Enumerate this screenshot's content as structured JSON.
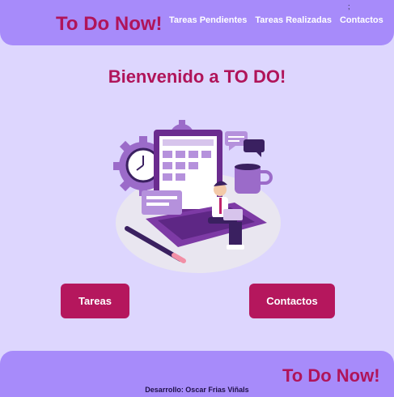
{
  "header": {
    "brand": "To Do Now!",
    "nav": [
      {
        "label": "Tareas Pendientes"
      },
      {
        "label": "Tareas Realizadas"
      },
      {
        "label": "Contactos"
      }
    ],
    "stray_mark": ";"
  },
  "main": {
    "welcome": "Bienvenido a TO DO!",
    "hero_image": "person-working-on-laptop-illustration",
    "buttons": {
      "tareas": "Tareas",
      "contactos": "Contactos"
    }
  },
  "footer": {
    "brand": "To Do Now!",
    "credit": "Desarrollo: Oscar Frias Viñals"
  },
  "colors": {
    "background": "#ddd6fe",
    "bar": "#a78bfa",
    "brand": "#b0145a",
    "button": "#b5175d"
  }
}
